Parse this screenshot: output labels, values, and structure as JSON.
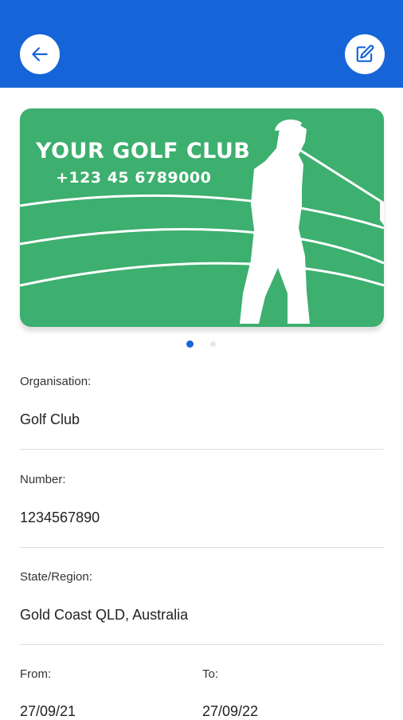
{
  "header": {
    "back_icon": "arrow-left-icon",
    "edit_icon": "edit-pencil-icon",
    "accent_color": "#1565d8"
  },
  "card": {
    "title": "YOUR GOLF CLUB",
    "phone": "+123 45 6789000",
    "background_color": "#3daf6f"
  },
  "carousel": {
    "total": 2,
    "active_index": 0
  },
  "fields": {
    "organisation": {
      "label": "Organisation:",
      "value": "Golf Club"
    },
    "number": {
      "label": "Number:",
      "value": "1234567890"
    },
    "state_region": {
      "label": "State/Region:",
      "value": "Gold Coast QLD, Australia"
    },
    "from": {
      "label": "From:",
      "value": "27/09/21"
    },
    "to": {
      "label": "To:",
      "value": "27/09/22"
    }
  }
}
